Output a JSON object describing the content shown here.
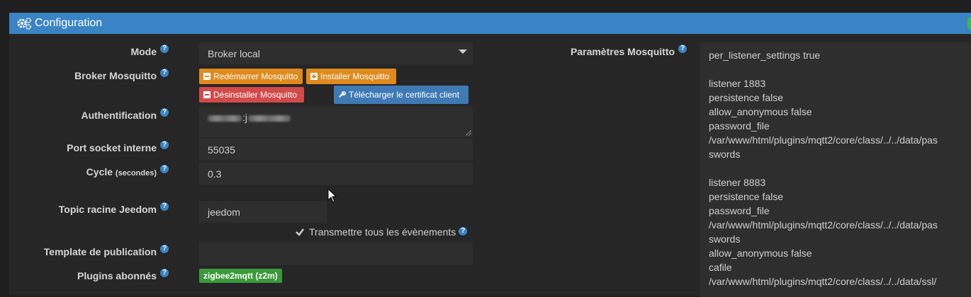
{
  "header": {
    "title": "Configuration",
    "icon": "cogs-icon"
  },
  "labels": {
    "mode": "Mode",
    "broker": "Broker Mosquitto",
    "auth": "Authentification",
    "port": "Port socket interne",
    "cycle": "Cycle",
    "cycle_unit": "(secondes)",
    "topic": "Topic racine Jeedom",
    "template": "Template de publication",
    "plugins": "Plugins abonnés",
    "params": "Paramètres Mosquitto",
    "help": "?"
  },
  "mode": {
    "value": "Broker local"
  },
  "buttons": {
    "restart": "Redémarrer Mosquitto",
    "install": "Installer Mosquitto",
    "uninstall": "Désinstaller Mosquitto",
    "download_cert": "Télécharger le certificat client"
  },
  "auth": {
    "separator": ":j"
  },
  "port": {
    "value": "55035"
  },
  "cycle": {
    "value": "0.3"
  },
  "topic": {
    "value": "jeedom"
  },
  "transmit": {
    "label": "Transmettre tous les évènements",
    "checked": true
  },
  "template": {
    "value": ""
  },
  "plugins": {
    "badge": "zigbee2mqtt (z2m)"
  },
  "mosquitto_params": {
    "lines": [
      "per_listener_settings true",
      "",
      "listener 1883",
      "persistence false",
      "allow_anonymous false",
      "password_file",
      "/var/www/html/plugins/mqtt2/core/class/../../data/pas",
      "swords",
      "",
      "listener 8883",
      "persistence false",
      "password_file",
      "/var/www/html/plugins/mqtt2/core/class/../../data/pas",
      "swords",
      "allow_anonymous false",
      "cafile",
      "/var/www/html/plugins/mqtt2/core/class/../../data/ssl/"
    ]
  },
  "colors": {
    "header": "#3a84c5",
    "orange": "#e08a1e",
    "red": "#d24a4a",
    "blue": "#3f7ab5",
    "green": "#3a9a3a"
  }
}
